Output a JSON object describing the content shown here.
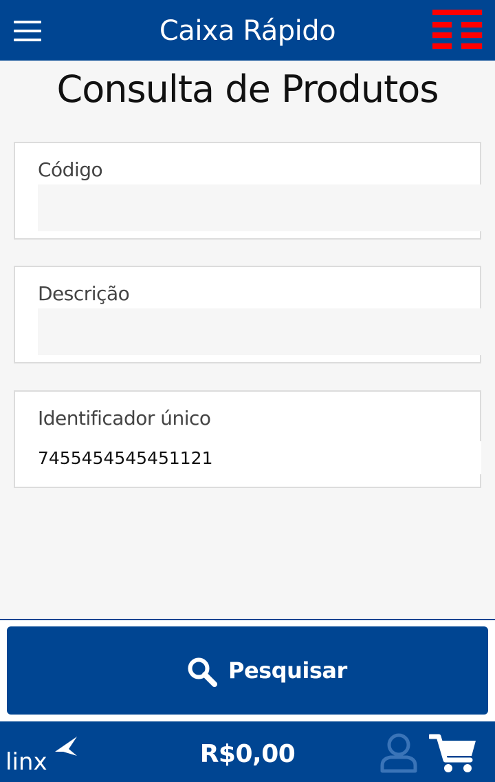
{
  "header": {
    "title": "Caixa Rápido",
    "accent_color": "#004592",
    "brand_icon": "brand-logo-red-stripes",
    "brand_color": "#ff0000"
  },
  "page": {
    "title": "Consulta de Produtos"
  },
  "fields": {
    "codigo": {
      "label": "Código",
      "value": ""
    },
    "descricao": {
      "label": "Descrição",
      "value": ""
    },
    "identificador": {
      "label": "Identificador único",
      "value": "7455454545451121"
    }
  },
  "actions": {
    "search_label": "Pesquisar",
    "search_icon": "search-icon"
  },
  "footer": {
    "logo_text": "linx",
    "total": "R$0,00",
    "user_icon": "user-icon",
    "cart_icon": "cart-icon"
  }
}
